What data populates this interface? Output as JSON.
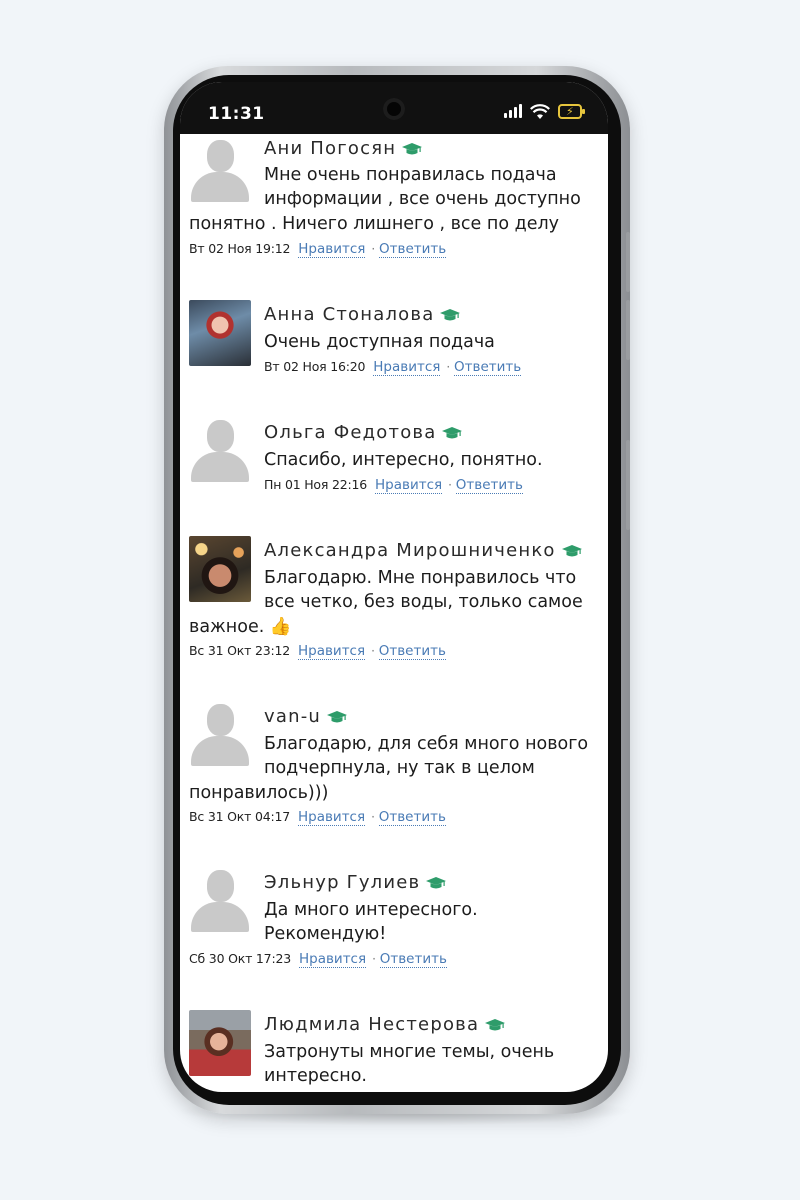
{
  "status_bar": {
    "time": "11:31"
  },
  "comments": [
    {
      "name": "Ани Погосян",
      "avatar": "placeholder",
      "lines": [
        "Мне очень понравилась подача",
        "информации , все очень доступно",
        "понятно . Ничего лишнего , все по делу"
      ],
      "date": "Вт 02 Ноя 19:12",
      "like": "Нравится",
      "reply": "Ответить"
    },
    {
      "name": "Анна Стоналова",
      "avatar": "photo",
      "lines": [
        "Очень доступная подача"
      ],
      "date": "Вт 02 Ноя 16:20",
      "like": "Нравится",
      "reply": "Ответить"
    },
    {
      "name": "Ольга Федотова",
      "avatar": "placeholder",
      "lines": [
        "Спасибо, интересно, понятно."
      ],
      "date": "Пн 01 Ноя 22:16",
      "like": "Нравится",
      "reply": "Ответить"
    },
    {
      "name": "Александра Мирошниченко",
      "avatar": "photo",
      "lines": [
        "Благодарю. Мне понравилось что",
        "все четко, без воды, только самое",
        "важное. 👍"
      ],
      "date": "Вс 31 Окт 23:12",
      "like": "Нравится",
      "reply": "Ответить"
    },
    {
      "name": "van-u",
      "avatar": "placeholder",
      "lines": [
        "Благодарю, для себя много нового",
        "подчерпнула, ну так в целом",
        "понравилось)))"
      ],
      "date": "Вс 31 Окт 04:17",
      "like": "Нравится",
      "reply": "Ответить"
    },
    {
      "name": "Эльнур Гулиев",
      "avatar": "placeholder",
      "lines": [
        "Да много интересного.",
        "Рекомендую!"
      ],
      "date": "Сб 30 Окт 17:23",
      "like": "Нравится",
      "reply": "Ответить"
    },
    {
      "name": "Людмила Нестерова",
      "avatar": "photo",
      "lines": [
        "Затронуты многие темы, очень",
        "интересно."
      ]
    }
  ],
  "colors": {
    "link": "#4a7bb5",
    "badge_green": "#2e9c6a",
    "battery": "#e6c53d"
  },
  "icons": {
    "badge": "graduation-cap-icon",
    "reply_separator": "·"
  }
}
